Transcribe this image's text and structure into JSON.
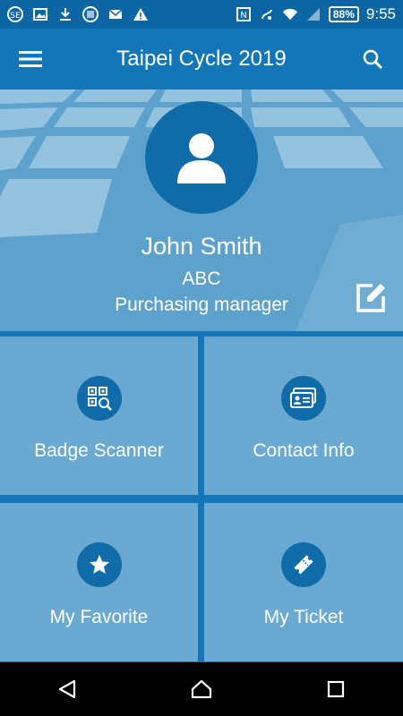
{
  "status_bar": {
    "time": "9:55",
    "battery": "88%",
    "left_icons": [
      "notification-app-icon",
      "image-icon",
      "download-icon",
      "barcode-icon",
      "mail-icon",
      "warning-icon"
    ],
    "right_icons": [
      "nfc-icon",
      "accessibility-icon",
      "wifi-icon",
      "signal-icon",
      "battery-icon"
    ]
  },
  "app_bar": {
    "title": "Taipei Cycle 2019",
    "menu_icon": "hamburger-menu-icon",
    "search_icon": "search-icon"
  },
  "profile": {
    "name": "John Smith",
    "company": "ABC",
    "job_title": "Purchasing manager",
    "avatar_icon": "person-icon",
    "edit_icon": "edit-icon"
  },
  "tiles": [
    {
      "label": "Badge Scanner",
      "icon": "qr-scan-icon"
    },
    {
      "label": "Contact Info",
      "icon": "contact-card-icon"
    },
    {
      "label": "My Favorite",
      "icon": "star-icon"
    },
    {
      "label": "My Ticket",
      "icon": "ticket-icon"
    }
  ],
  "nav_bar": {
    "back_icon": "back-triangle-icon",
    "home_icon": "home-icon",
    "recents_icon": "recents-square-icon"
  },
  "colors": {
    "status_bar": "#0b66a3",
    "app_bar": "#1276b8",
    "profile_bg": "#5ca2cd",
    "tile_bg": "#6aa9d1",
    "icon_circle": "#0f6ca8"
  }
}
